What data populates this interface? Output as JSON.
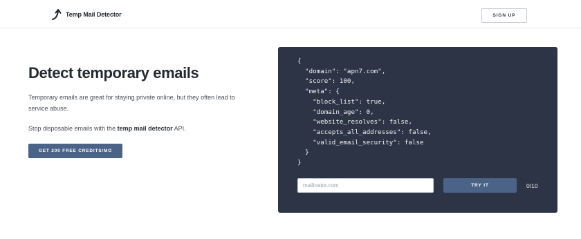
{
  "header": {
    "logo_text": "Temp Mail Detector",
    "logo_icon": "arrow-up-curve-icon",
    "signup_label": "SIGN UP"
  },
  "hero": {
    "title": "Detect temporary emails",
    "description": "Temporary emails are great for staying private online, but they often lead to service abuse.",
    "stop_prefix": "Stop disposable emails with the ",
    "stop_bold": "temp mail detector",
    "stop_suffix": " API.",
    "cta_label": "GET 200 FREE CREDITS/MO"
  },
  "demo": {
    "code": "{\n  \"domain\": \"apn7.com\",\n  \"score\": 100,\n  \"meta\": {\n    \"block_list\": true,\n    \"domain_age\": 0,\n    \"website_resolves\": false,\n    \"accepts_all_addresses\": false,\n    \"valid_email_security\": false\n  }\n}",
    "input_placeholder": "mailinator.com",
    "input_value": "",
    "try_label": "TRY IT",
    "counter": "0/10"
  },
  "colors": {
    "panel_bg": "#2c3446",
    "button_bg": "#4a6387",
    "text_dark": "#252a31"
  }
}
